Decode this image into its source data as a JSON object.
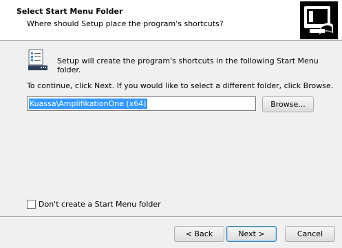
{
  "header": {
    "title": "Select Start Menu Folder",
    "subtitle": "Where should Setup place the program's shortcuts?"
  },
  "body": {
    "intro": "Setup will create the program's shortcuts in the following Start Menu folder.",
    "instruction": "To continue, click Next. If you would like to select a different folder, click Browse.",
    "folder_value": "Kuassa\\AmplifikationOne (x64)",
    "browse_label": "Browse...",
    "no_folder_label": "Don't create a Start Menu folder",
    "no_folder_checked": false
  },
  "footer": {
    "back_label": "< Back",
    "next_label": "Next >",
    "cancel_label": "Cancel"
  },
  "icons": {
    "header_logo": "computer-setup-icon",
    "folder_icon": "start-menu-folder-icon"
  },
  "colors": {
    "selection": "#3399ff",
    "default_button_border": "#3c7fb1"
  }
}
